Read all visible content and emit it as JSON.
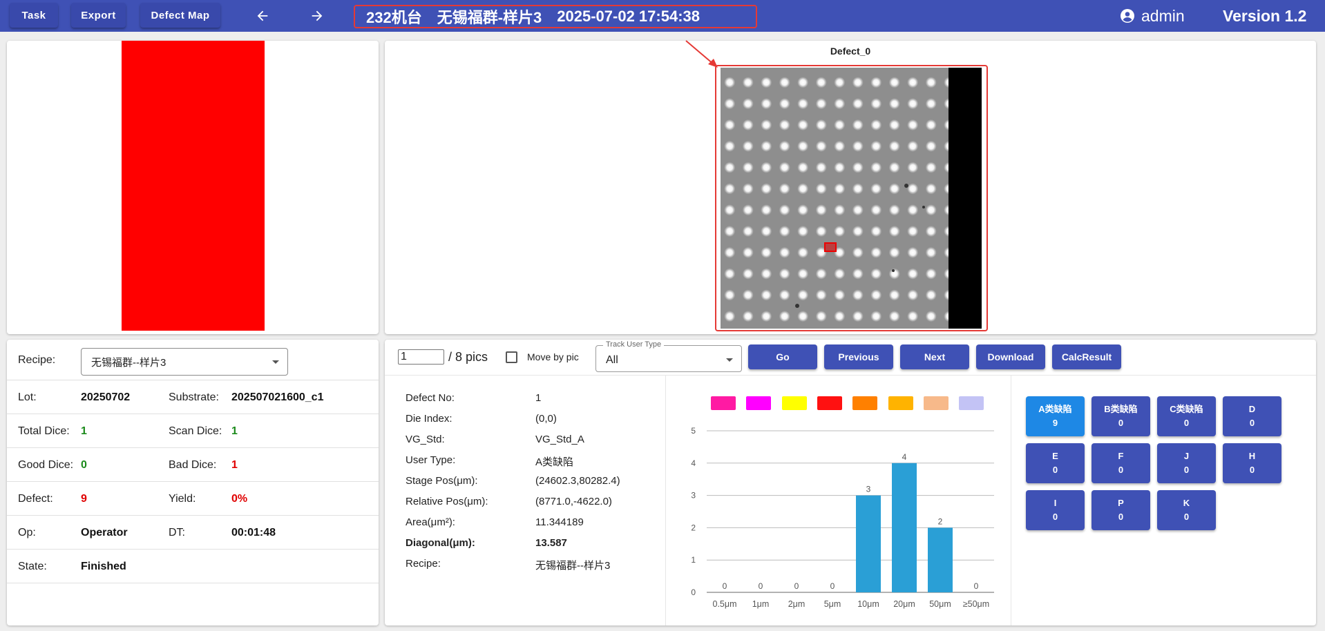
{
  "toolbar": {
    "buttons": [
      "Task",
      "Export",
      "Defect Map"
    ],
    "headline": {
      "machine": "232机台",
      "sample": "无锡福群-样片3",
      "datetime": "2025-07-02 17:54:38"
    },
    "user": "admin",
    "version": "Version 1.2"
  },
  "image_view": {
    "title": "Defect_0"
  },
  "info": {
    "recipe_label": "Recipe:",
    "recipe_value": "无锡福群--样片3",
    "lot_label": "Lot:",
    "lot": "20250702",
    "substrate_label": "Substrate:",
    "substrate": "202507021600_c1",
    "total_dice_label": "Total Dice:",
    "total_dice": "1",
    "scan_dice_label": "Scan Dice:",
    "scan_dice": "1",
    "good_dice_label": "Good Dice:",
    "good_dice": "0",
    "bad_dice_label": "Bad Dice:",
    "bad_dice": "1",
    "defect_label": "Defect:",
    "defect": "9",
    "yield_label": "Yield:",
    "yield": "0%",
    "op_label": "Op:",
    "op": "Operator",
    "dt_label": "DT:",
    "dt": "00:01:48",
    "state_label": "State:",
    "state": "Finished"
  },
  "pager": {
    "current": "1",
    "total": "/ 8 pics",
    "move_by_pic": "Move by pic",
    "track_label": "Track User Type",
    "track_value": "All",
    "actions": [
      "Go",
      "Previous",
      "Next",
      "Download",
      "CalcResult"
    ]
  },
  "defect_details": [
    {
      "key": "Defect No:",
      "value": "1"
    },
    {
      "key": "Die Index:",
      "value": "(0,0)"
    },
    {
      "key": "VG_Std:",
      "value": "VG_Std_A"
    },
    {
      "key": "User Type:",
      "value": "A类缺陷"
    },
    {
      "key": "Stage Pos(μm):",
      "value": "(24602.3,80282.4)"
    },
    {
      "key": "Relative Pos(μm):",
      "value": "(8771.0,-4622.0)"
    },
    {
      "key": "Area(μm²):",
      "value": "11.344189"
    },
    {
      "key": "Diagonal(μm):",
      "value": "13.587"
    },
    {
      "key": "Recipe:",
      "value": "无锡福群--样片3"
    }
  ],
  "legend_colors": [
    "#ff1aa3",
    "#ff00ff",
    "#ffff00",
    "#ff1111",
    "#ff8000",
    "#ffb300",
    "#f7b98a",
    "#c3c3f5"
  ],
  "chart_data": {
    "type": "bar",
    "categories": [
      "0.5μm",
      "1μm",
      "2μm",
      "5μm",
      "10μm",
      "20μm",
      "50μm",
      "≥50μm"
    ],
    "values": [
      0,
      0,
      0,
      0,
      3,
      4,
      2,
      0
    ],
    "ylim": [
      0,
      5
    ],
    "yticks": [
      "0",
      "1",
      "2",
      "3",
      "4",
      "5"
    ],
    "grid": true,
    "bar_color": "#2a9fd6"
  },
  "categories": [
    {
      "name": "A类缺陷",
      "count": "9",
      "active": true
    },
    {
      "name": "B类缺陷",
      "count": "0"
    },
    {
      "name": "C类缺陷",
      "count": "0"
    },
    {
      "name": "D",
      "count": "0"
    },
    {
      "name": "E",
      "count": "0"
    },
    {
      "name": "F",
      "count": "0"
    },
    {
      "name": "J",
      "count": "0"
    },
    {
      "name": "H",
      "count": "0"
    },
    {
      "name": "I",
      "count": "0"
    },
    {
      "name": "P",
      "count": "0"
    },
    {
      "name": "K",
      "count": "0"
    }
  ]
}
